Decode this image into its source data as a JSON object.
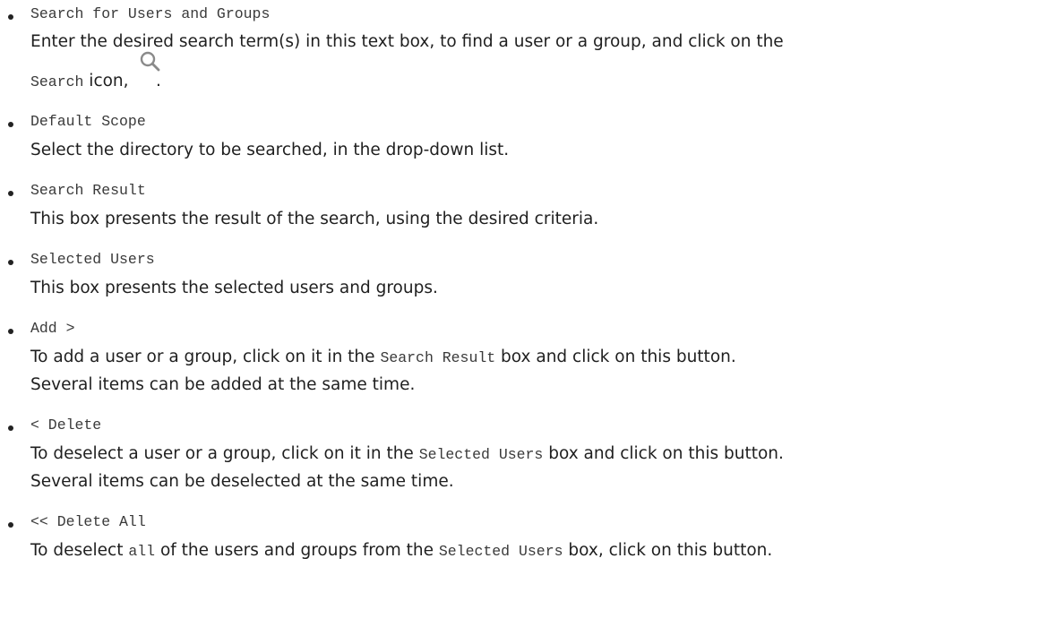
{
  "items": [
    {
      "term": "Search for Users and Groups",
      "line1": "Enter the desired search term(s) in this text box, to find a user or a group, and click on the",
      "line2_mono": "Search",
      "line2_text": " icon,",
      "line2_end": " .",
      "icon": "magnifier-icon"
    },
    {
      "term": "Default Scope",
      "line1": "Select the directory to be searched, in the drop-down list."
    },
    {
      "term": "Search Result",
      "line1": "This box presents the result of the search, using the desired criteria."
    },
    {
      "term": "Selected Users",
      "line1": "This box presents the selected users and groups."
    },
    {
      "term": "Add >",
      "line1_pre": "To add a user or a group, click on it in the ",
      "line1_mono": "Search Result",
      "line1_post": " box and click on this button.",
      "line2": "Several items can be added at the same time."
    },
    {
      "term": "< Delete",
      "line1_pre": "To deselect a user or a group, click on it in the ",
      "line1_mono": "Selected Users",
      "line1_post": " box and click on this button.",
      "line2": "Several items can be deselected at the same time."
    },
    {
      "term": "<< Delete All",
      "line1_pre": "To deselect ",
      "line1_mono": "all",
      "line1_mid": " of the users and groups from the ",
      "line1_mono2": "Selected Users",
      "line1_post": " box, click on this button."
    }
  ]
}
